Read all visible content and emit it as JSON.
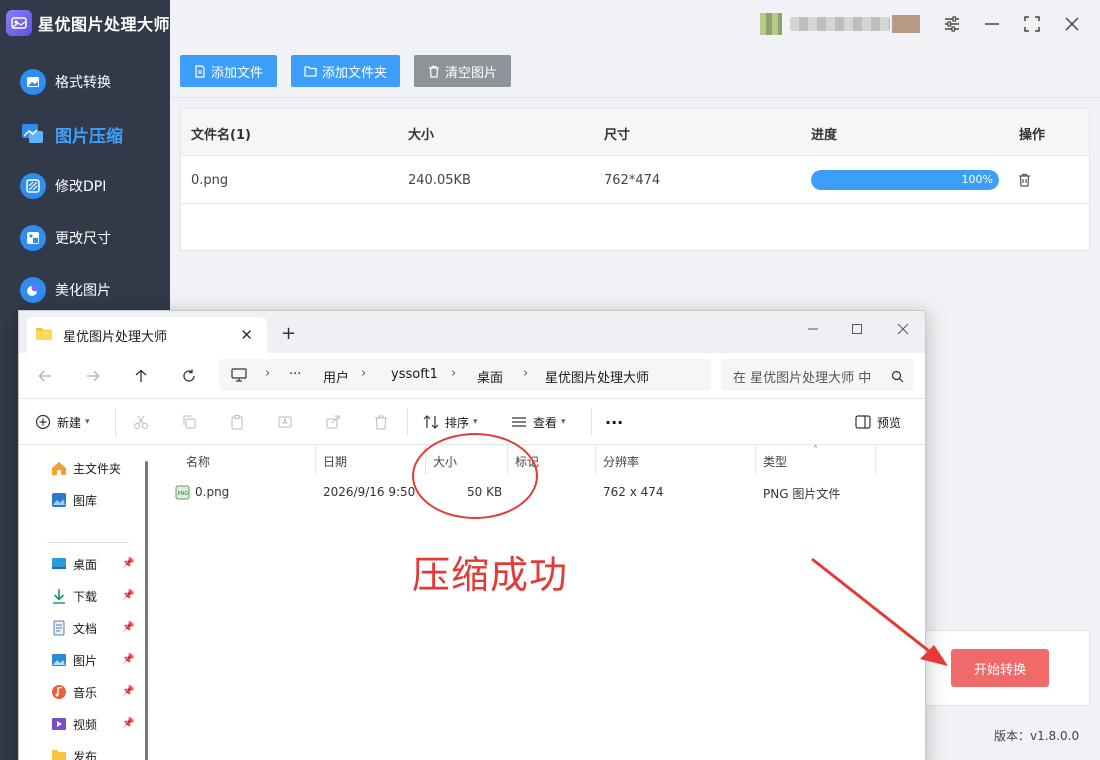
{
  "app": {
    "title": "星优图片处理大师",
    "accent": "#3d9ef8",
    "sidebar_bg": "#323a4a"
  },
  "sidebar": {
    "items": [
      {
        "label": "格式转换",
        "icon": "image-convert-icon"
      },
      {
        "label": "图片压缩",
        "icon": "image-compress-icon",
        "active": true
      },
      {
        "label": "修改DPI",
        "icon": "dpi-icon"
      },
      {
        "label": "更改尺寸",
        "icon": "resize-icon"
      },
      {
        "label": "美化图片",
        "icon": "beautify-icon"
      }
    ]
  },
  "toolbar": {
    "add_file": "添加文件",
    "add_folder": "添加文件夹",
    "clear": "清空图片"
  },
  "table": {
    "headers": [
      "文件名(1)",
      "大小",
      "尺寸",
      "进度",
      "操作"
    ],
    "rows": [
      {
        "name": "0.png",
        "size": "240.05KB",
        "dims": "762*474",
        "progress_text": "100%",
        "progress": 1.0
      }
    ]
  },
  "start_button": "开始转换",
  "version": "版本：v1.8.0.0",
  "explorer": {
    "tab_title": "星优图片处理大师",
    "breadcrumb": [
      "···",
      "用户",
      "yssoft1",
      "桌面",
      "星优图片处理大师"
    ],
    "search_placeholder": "在 星优图片处理大师 中",
    "commands": {
      "new": "新建",
      "sort": "排序",
      "view": "查看",
      "more": "···",
      "preview": "预览"
    },
    "nav": [
      {
        "label": "主文件夹",
        "icon": "home-icon"
      },
      {
        "label": "图库",
        "icon": "gallery-icon"
      },
      {
        "label": "桌面",
        "icon": "desktop-icon"
      },
      {
        "label": "下载",
        "icon": "download-icon"
      },
      {
        "label": "文档",
        "icon": "document-icon"
      },
      {
        "label": "图片",
        "icon": "pictures-icon"
      },
      {
        "label": "音乐",
        "icon": "music-icon"
      },
      {
        "label": "视频",
        "icon": "video-icon"
      },
      {
        "label": "发布",
        "icon": "folder-icon"
      }
    ],
    "columns": [
      "名称",
      "日期",
      "大小",
      "标记",
      "分辨率",
      "类型"
    ],
    "files": [
      {
        "name": "0.png",
        "date": "2026/9/16 9:50",
        "size": "50 KB",
        "tag": "",
        "resolution": "762 x 474",
        "type": "PNG 图片文件"
      }
    ]
  },
  "annotation": {
    "text": "压缩成功",
    "color": "#e53935"
  }
}
